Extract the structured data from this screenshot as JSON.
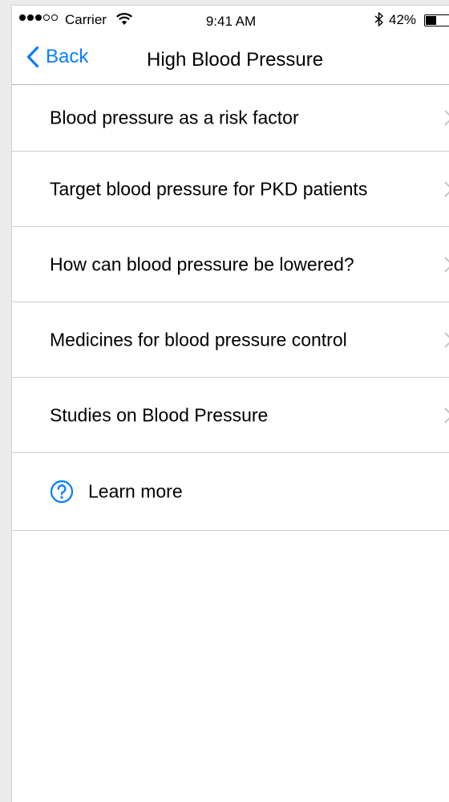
{
  "status_bar": {
    "carrier": "Carrier",
    "time": "9:41 AM",
    "battery_percent": "42%",
    "battery_level": 0.42,
    "signal_bars_filled": 3,
    "signal_bars_total": 5,
    "icons": [
      "wifi-icon",
      "bluetooth-icon",
      "battery-icon"
    ]
  },
  "nav": {
    "back_label": "Back",
    "title": "High Blood Pressure"
  },
  "list": {
    "items": [
      {
        "label": "Blood pressure as a risk factor"
      },
      {
        "label": "Target blood pressure for PKD patients"
      },
      {
        "label": "How can blood pressure be lowered?"
      },
      {
        "label": "Medicines for blood pressure control"
      },
      {
        "label": "Studies on Blood Pressure"
      }
    ],
    "learn_more": {
      "label": "Learn more",
      "icon": "question-circle-icon"
    }
  },
  "colors": {
    "accent": "#0a7cff",
    "separator": "#cccccc",
    "chevron": "#c7c7cc"
  }
}
